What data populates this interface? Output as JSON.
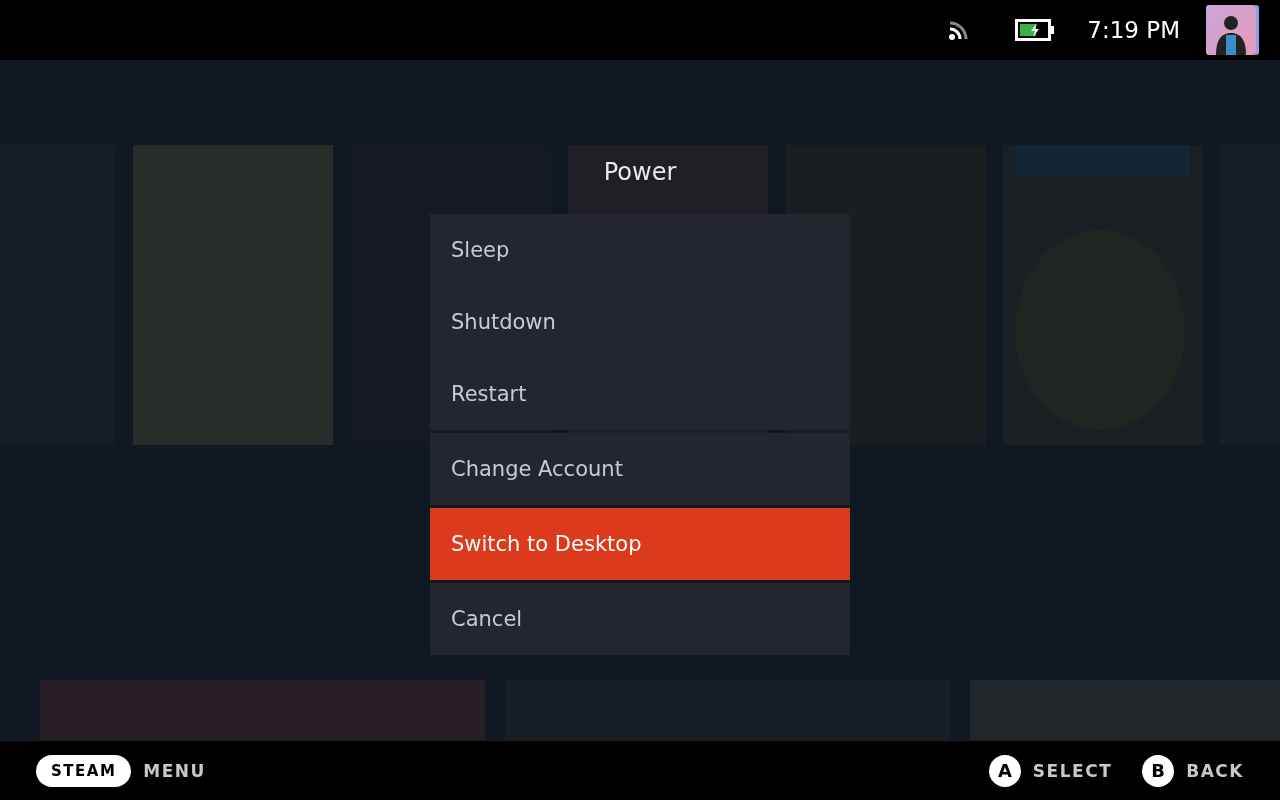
{
  "status_bar": {
    "time": "7:19 PM"
  },
  "dialog": {
    "title": "Power",
    "groups": [
      {
        "items": [
          {
            "label": "Sleep",
            "selected": false
          },
          {
            "label": "Shutdown",
            "selected": false
          },
          {
            "label": "Restart",
            "selected": false
          }
        ]
      },
      {
        "items": [
          {
            "label": "Change Account",
            "selected": false
          }
        ]
      },
      {
        "items": [
          {
            "label": "Switch to Desktop",
            "selected": true
          }
        ]
      },
      {
        "items": [
          {
            "label": "Cancel",
            "selected": false
          }
        ]
      }
    ]
  },
  "footer": {
    "left": [
      {
        "key": "STEAM",
        "label": "MENU",
        "kind": "pill"
      }
    ],
    "right": [
      {
        "key": "A",
        "label": "SELECT",
        "kind": "circle"
      },
      {
        "key": "B",
        "label": "BACK",
        "kind": "circle"
      }
    ]
  }
}
